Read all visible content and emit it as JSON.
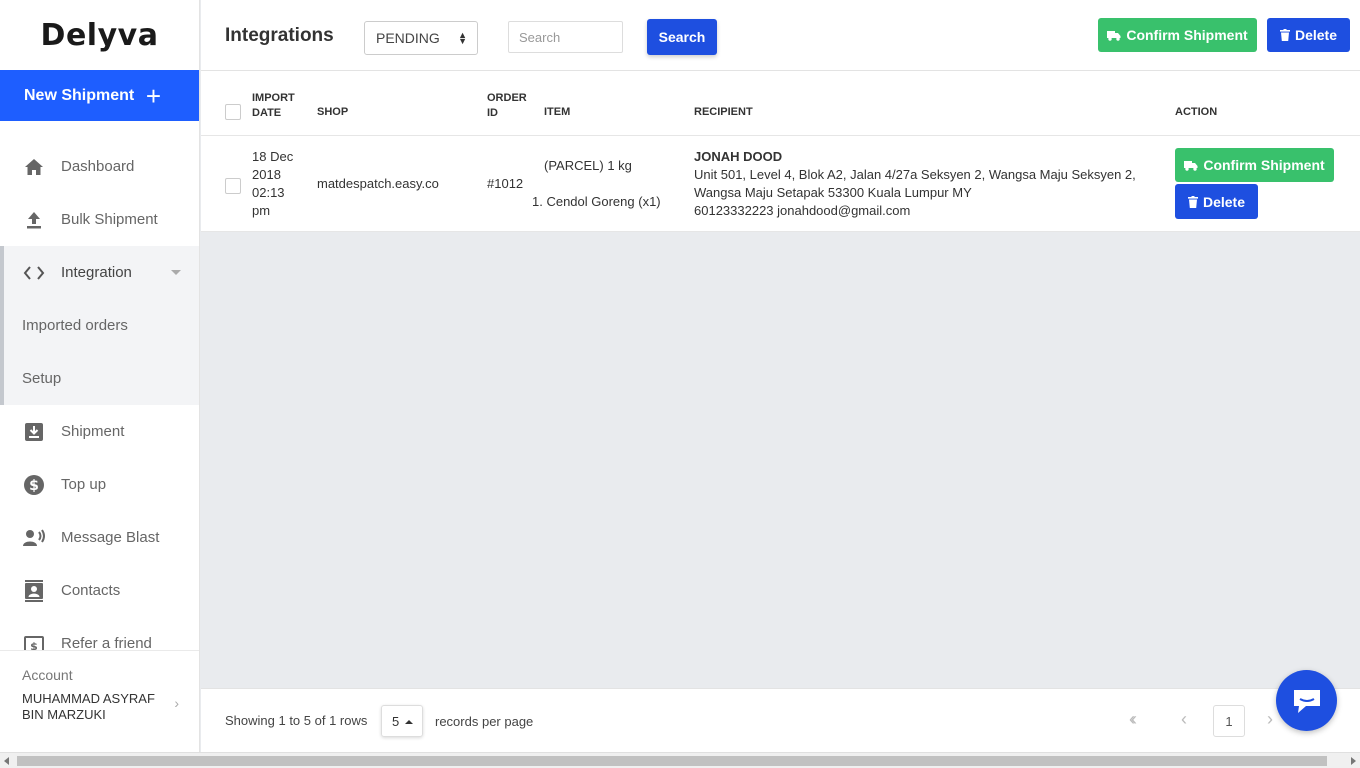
{
  "brand": {
    "logo_text": "Delyva",
    "accent": "#1e5eff",
    "green": "#39c16c"
  },
  "sidebar": {
    "new_shipment": "New Shipment",
    "items": [
      {
        "label": "Dashboard",
        "icon": "home-icon"
      },
      {
        "label": "Bulk Shipment",
        "icon": "upload-icon"
      },
      {
        "label": "Integration",
        "icon": "code-icon"
      },
      {
        "label": "Shipment",
        "icon": "download-box-icon"
      },
      {
        "label": "Top up",
        "icon": "dollar-circle-icon"
      },
      {
        "label": "Message Blast",
        "icon": "broadcast-user-icon"
      },
      {
        "label": "Contacts",
        "icon": "contacts-icon"
      },
      {
        "label": "Refer a friend",
        "icon": "dollar-doc-icon"
      }
    ],
    "integration_sub": [
      "Imported orders",
      "Setup"
    ],
    "account_label": "Account",
    "account_name": "MUHAMMAD ASYRAF BIN MARZUKI"
  },
  "header": {
    "title": "Integrations",
    "status_value": "PENDING",
    "search_placeholder": "Search",
    "search_button": "Search",
    "confirm_button": "Confirm Shipment",
    "delete_button": "Delete"
  },
  "table": {
    "columns": {
      "import_date_1": "IMPORT",
      "import_date_2": "DATE",
      "shop": "SHOP",
      "order_id_1": "ORDER",
      "order_id_2": "ID",
      "item": "ITEM",
      "recipient": "RECIPIENT",
      "action": "ACTION"
    },
    "rows": [
      {
        "date_1": "18 Dec",
        "date_2": "2018",
        "date_3": "02:13",
        "date_4": "pm",
        "shop": "matdespatch.easy.co",
        "order_id": "#1012",
        "item_type": "(PARCEL) 1 kg",
        "item_line": "1. Cendol Goreng (x1)",
        "recipient_name": "JONAH DOOD",
        "address_1": "Unit 501, Level 4, Blok A2, Jalan 4/27a Seksyen 2, Wangsa Maju Seksyen 2,",
        "address_2": "Wangsa Maju Setapak 53300 Kuala Lumpur MY",
        "contact": "60123332223 jonahdood@gmail.com",
        "confirm_label": "Confirm Shipment",
        "delete_label": "Delete"
      }
    ]
  },
  "footer": {
    "showing": "Showing 1 to 5 of 1 rows",
    "per_page": "5",
    "per_page_label": "records per page",
    "current_page": "1"
  }
}
